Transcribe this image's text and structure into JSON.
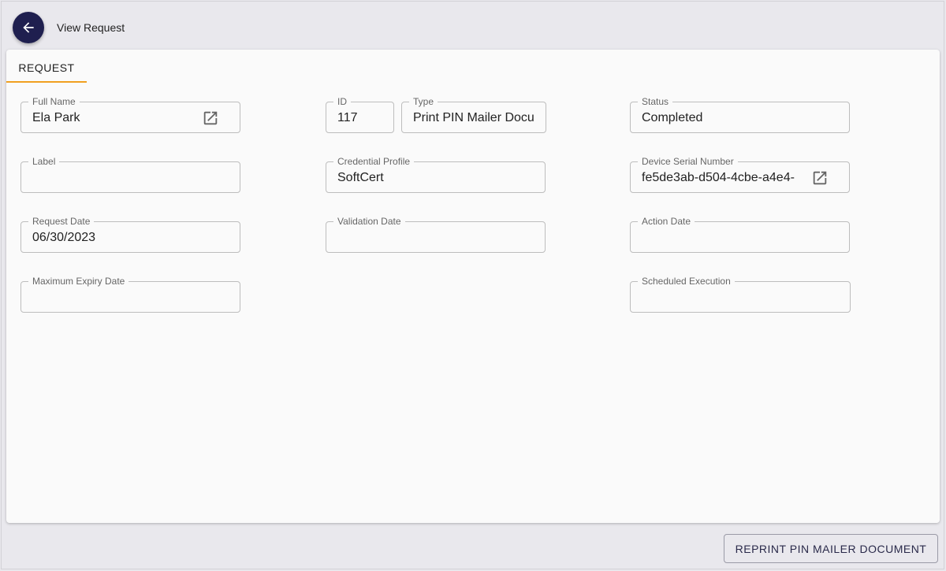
{
  "header": {
    "title": "View Request",
    "back_icon": "arrow-left-icon"
  },
  "tabs": [
    {
      "label": "REQUEST",
      "active": true
    }
  ],
  "fields": {
    "full_name": {
      "label": "Full Name",
      "value": "Ela Park",
      "icon": "open-in-new-icon"
    },
    "id": {
      "label": "ID",
      "value": "117"
    },
    "type": {
      "label": "Type",
      "value": "Print PIN Mailer Docu"
    },
    "status": {
      "label": "Status",
      "value": "Completed"
    },
    "label": {
      "label": "Label",
      "value": ""
    },
    "credential_profile": {
      "label": "Credential Profile",
      "value": "SoftCert"
    },
    "device_serial_number": {
      "label": "Device Serial Number",
      "value": "fe5de3ab-d504-4cbe-a4e4-",
      "icon": "open-in-new-icon"
    },
    "request_date": {
      "label": "Request Date",
      "value": "06/30/2023"
    },
    "validation_date": {
      "label": "Validation Date",
      "value": ""
    },
    "action_date": {
      "label": "Action Date",
      "value": ""
    },
    "maximum_expiry_date": {
      "label": "Maximum Expiry Date",
      "value": ""
    },
    "scheduled_execution": {
      "label": "Scheduled Execution",
      "value": ""
    }
  },
  "footer": {
    "reprint_label": "REPRINT PIN MAILER DOCUMENT"
  },
  "colors": {
    "accent": "#f0a020",
    "primary": "#1f1f4f",
    "background": "#e9e8ed",
    "card": "#fafafa"
  }
}
